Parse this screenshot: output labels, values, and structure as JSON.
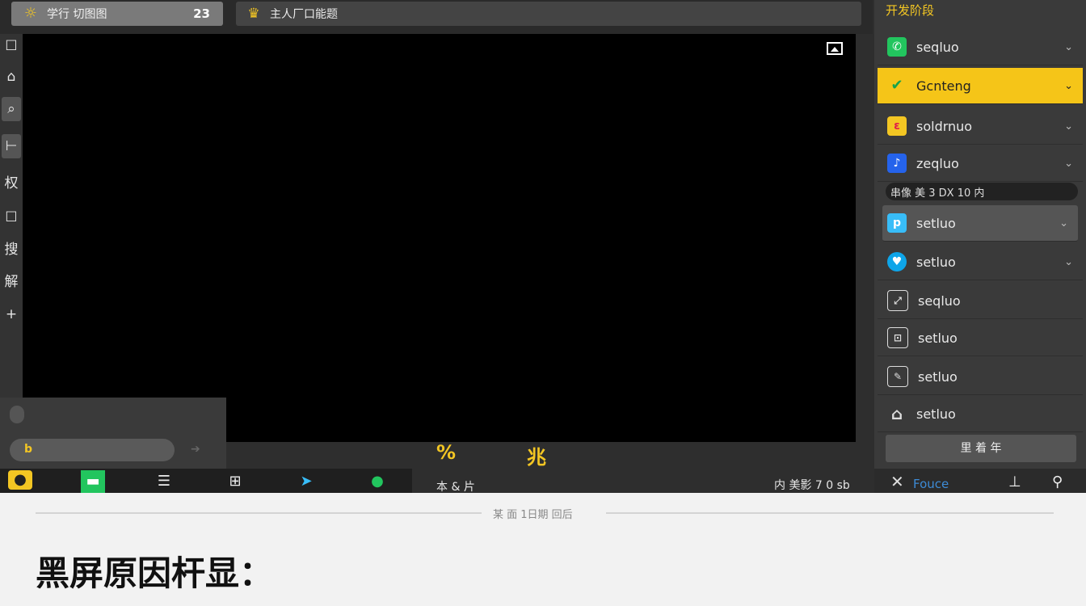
{
  "top_tabs": [
    {
      "label": "学行 切图图",
      "count": "23",
      "icon": "sun-icon"
    },
    {
      "label": "主人厂口能题",
      "icon": "crown-icon"
    }
  ],
  "left_toolbar": [
    "☐",
    "⌂",
    "⌕",
    "⊢",
    "权",
    "☐",
    "搜",
    "解",
    "+"
  ],
  "video": {
    "icon": "picture-icon"
  },
  "lower_controls": {
    "pill_letter": "b",
    "pct": "%",
    "yel2": "兆"
  },
  "dock": {
    "items": [
      "dock-app1",
      "dock-app2",
      "dock-menu",
      "dock-grid",
      "dock-send",
      "dock-run"
    ],
    "status_left": "本 & 片",
    "status_right": "内 美影 7 0 sb"
  },
  "right_panel": {
    "title": "开发阶段",
    "items": [
      {
        "label": "seqluo",
        "icon": "phone-icon",
        "color": "#22c55e"
      },
      {
        "label": "Gcnteng",
        "icon": "check-icon",
        "color": "#16a34a"
      },
      {
        "label": "soldrnuo",
        "icon": "flame-icon",
        "color": "#f97316"
      },
      {
        "label": "zeqluo",
        "icon": "music-icon",
        "color": "#2563eb"
      },
      {
        "label": "setluo",
        "icon": "p-icon",
        "color": "#38bdf8"
      },
      {
        "label": "setluo",
        "icon": "heart-icon",
        "color": "#0ea5e9"
      },
      {
        "label": "seqluo",
        "icon": "box-icon"
      },
      {
        "label": "setluo",
        "icon": "frame-icon"
      },
      {
        "label": "setluo",
        "icon": "edit-icon"
      },
      {
        "label": "setluo",
        "icon": "home-icon"
      }
    ],
    "search_text": "串像 美 3 DX 10 内",
    "button": "里 着 年",
    "bottom": {
      "label": "Fouce"
    }
  },
  "doc": {
    "caption": "某 面 1日期 回后",
    "heading": "黑屏原因杆显："
  }
}
